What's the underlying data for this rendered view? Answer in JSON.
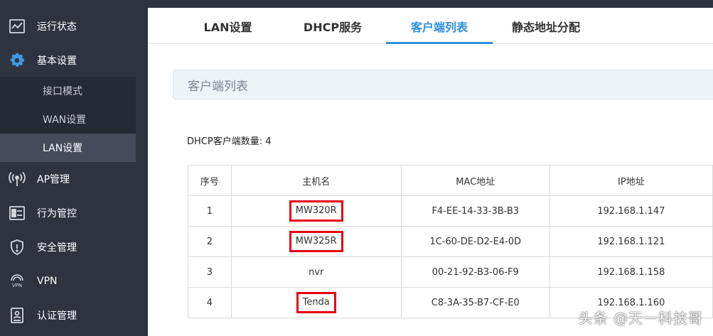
{
  "sidebar": {
    "items": [
      {
        "label": "运行状态",
        "icon": "chart-icon"
      },
      {
        "label": "基本设置",
        "icon": "gear-icon"
      },
      {
        "label": "AP管理",
        "icon": "antenna-icon"
      },
      {
        "label": "行为管控",
        "icon": "monitor-icon"
      },
      {
        "label": "安全管理",
        "icon": "shield-icon"
      },
      {
        "label": "VPN",
        "icon": "vpn-icon"
      },
      {
        "label": "认证管理",
        "icon": "id-card-icon"
      }
    ],
    "sub_items": [
      {
        "label": "接口模式"
      },
      {
        "label": "WAN设置"
      },
      {
        "label": "LAN设置"
      }
    ]
  },
  "tabs": [
    {
      "label": "LAN设置"
    },
    {
      "label": "DHCP服务"
    },
    {
      "label": "客户端列表"
    },
    {
      "label": "静态地址分配"
    }
  ],
  "panel": {
    "title": "客户端列表",
    "count_label": "DHCP客户端数量: 4"
  },
  "table": {
    "headers": [
      "序号",
      "主机名",
      "MAC地址",
      "IP地址"
    ],
    "rows": [
      {
        "index": "1",
        "hostname": "MW320R",
        "mac": "F4-EE-14-33-3B-B3",
        "ip": "192.168.1.147"
      },
      {
        "index": "2",
        "hostname": "MW325R",
        "mac": "1C-60-DE-D2-E4-0D",
        "ip": "192.168.1.121"
      },
      {
        "index": "3",
        "hostname": "nvr",
        "mac": "00-21-92-B3-06-F9",
        "ip": "192.168.1.158"
      },
      {
        "index": "4",
        "hostname": "Tenda",
        "mac": "C8-3A-35-B7-CF-E0",
        "ip": "192.168.1.160"
      }
    ]
  },
  "watermark": "头条 @天一科技哥",
  "colors": {
    "sidebar_bg": "#2f3340",
    "accent": "#2f8fe0",
    "highlight_box": "#e60012"
  }
}
